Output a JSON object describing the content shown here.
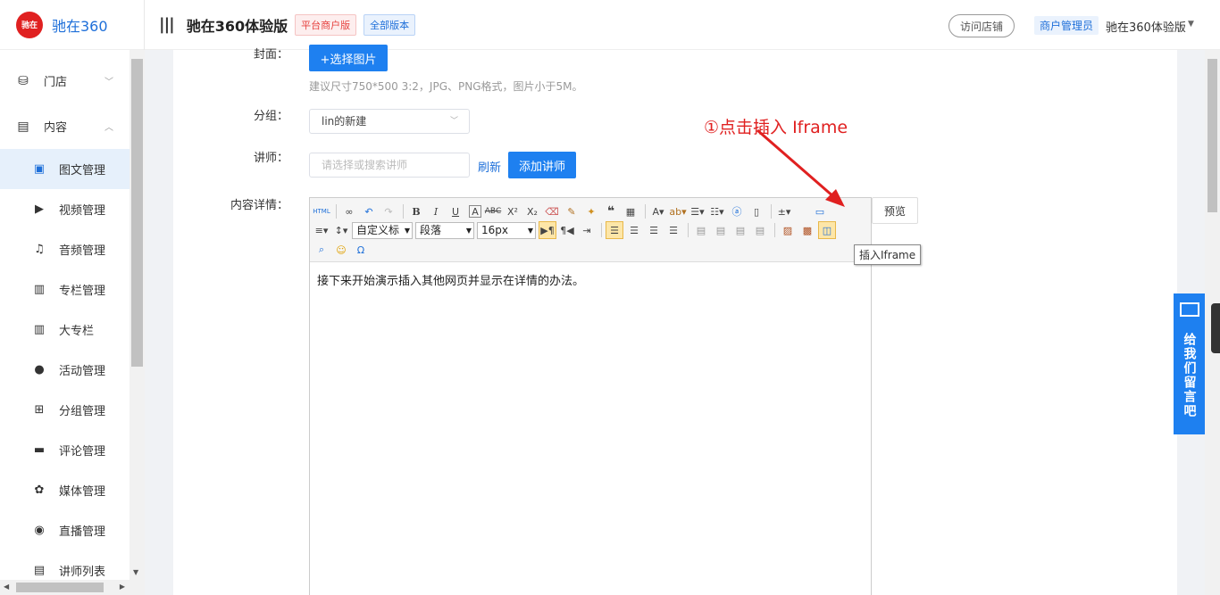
{
  "brand": {
    "logo_text": "驰在",
    "name": "驰在360"
  },
  "header": {
    "menu_icon": "|||",
    "title": "驰在360体验版",
    "tag_platform": "平台商户版",
    "tag_version": "全部版本",
    "visit_store": "访问店铺",
    "role": "商户管理员",
    "user": "驰在360体验版"
  },
  "sidebar": {
    "groups": [
      {
        "label": "门店",
        "icon": "store-icon",
        "expanded": false
      },
      {
        "label": "内容",
        "icon": "content-icon",
        "expanded": true
      }
    ],
    "items": [
      {
        "label": "图文管理",
        "icon": "article-icon",
        "active": true
      },
      {
        "label": "视频管理",
        "icon": "video-icon"
      },
      {
        "label": "音频管理",
        "icon": "audio-icon"
      },
      {
        "label": "专栏管理",
        "icon": "column-icon"
      },
      {
        "label": "大专栏",
        "icon": "big-column-icon"
      },
      {
        "label": "活动管理",
        "icon": "activity-icon"
      },
      {
        "label": "分组管理",
        "icon": "group-icon"
      },
      {
        "label": "评论管理",
        "icon": "comment-icon"
      },
      {
        "label": "媒体管理",
        "icon": "media-icon"
      },
      {
        "label": "直播管理",
        "icon": "live-icon"
      },
      {
        "label": "讲师列表",
        "icon": "teacher-list-icon"
      }
    ]
  },
  "form": {
    "cover_label": "封面：",
    "choose_image": "+选择图片",
    "cover_hint": "建议尺寸750*500 3:2，JPG、PNG格式，图片小于5M。",
    "group_label": "分组：",
    "group_value": "lin的新建",
    "teacher_label": "讲师：",
    "teacher_placeholder": "请选择或搜索讲师",
    "refresh": "刷新",
    "add_teacher": "添加讲师",
    "content_label": "内容详情：",
    "preview": "预览"
  },
  "editor": {
    "font_family": "自定义标",
    "paragraph": "段落",
    "font_size": "16px",
    "content": "接下来开始演示插入其他网页并显示在详情的办法。",
    "tooltip": "插入Iframe"
  },
  "annotation": "①点击插入 Iframe",
  "feedback": "给我们留言吧",
  "colors": {
    "primary": "#1e80f0",
    "annotation": "#e02020"
  }
}
